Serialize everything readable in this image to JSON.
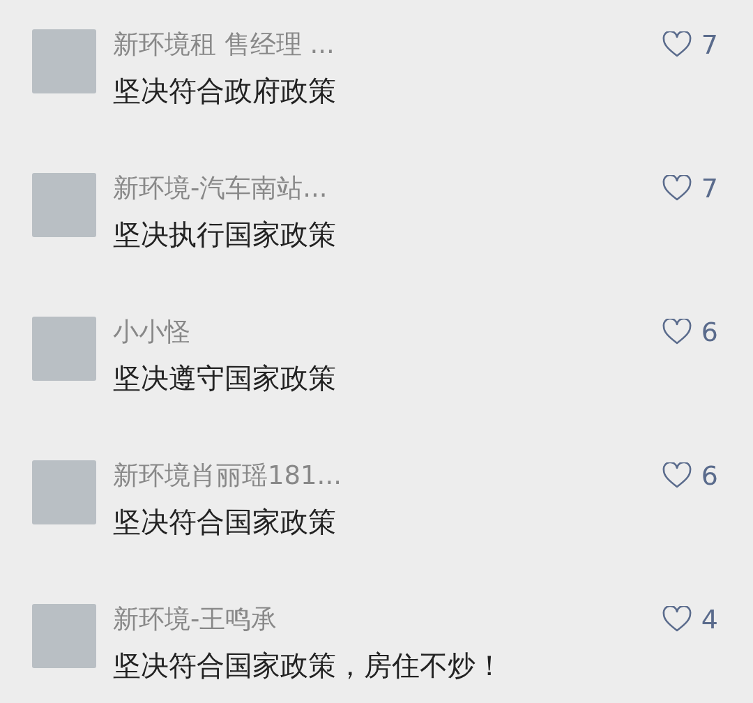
{
  "comments": [
    {
      "name": "新环境租 售经理 ...",
      "text": "坚决符合政府政策",
      "likes": "7"
    },
    {
      "name": "新环境-汽车南站...",
      "text": "坚决执行国家政策",
      "likes": "7"
    },
    {
      "name": "小小怪",
      "text": "坚决遵守国家政策",
      "likes": "6"
    },
    {
      "name": "新环境肖丽瑶181...",
      "text": "坚决符合国家政策",
      "likes": "6"
    },
    {
      "name": "新环境-王鸣承",
      "text": "坚决符合国家政策，房住不炒！",
      "likes": "4"
    }
  ]
}
